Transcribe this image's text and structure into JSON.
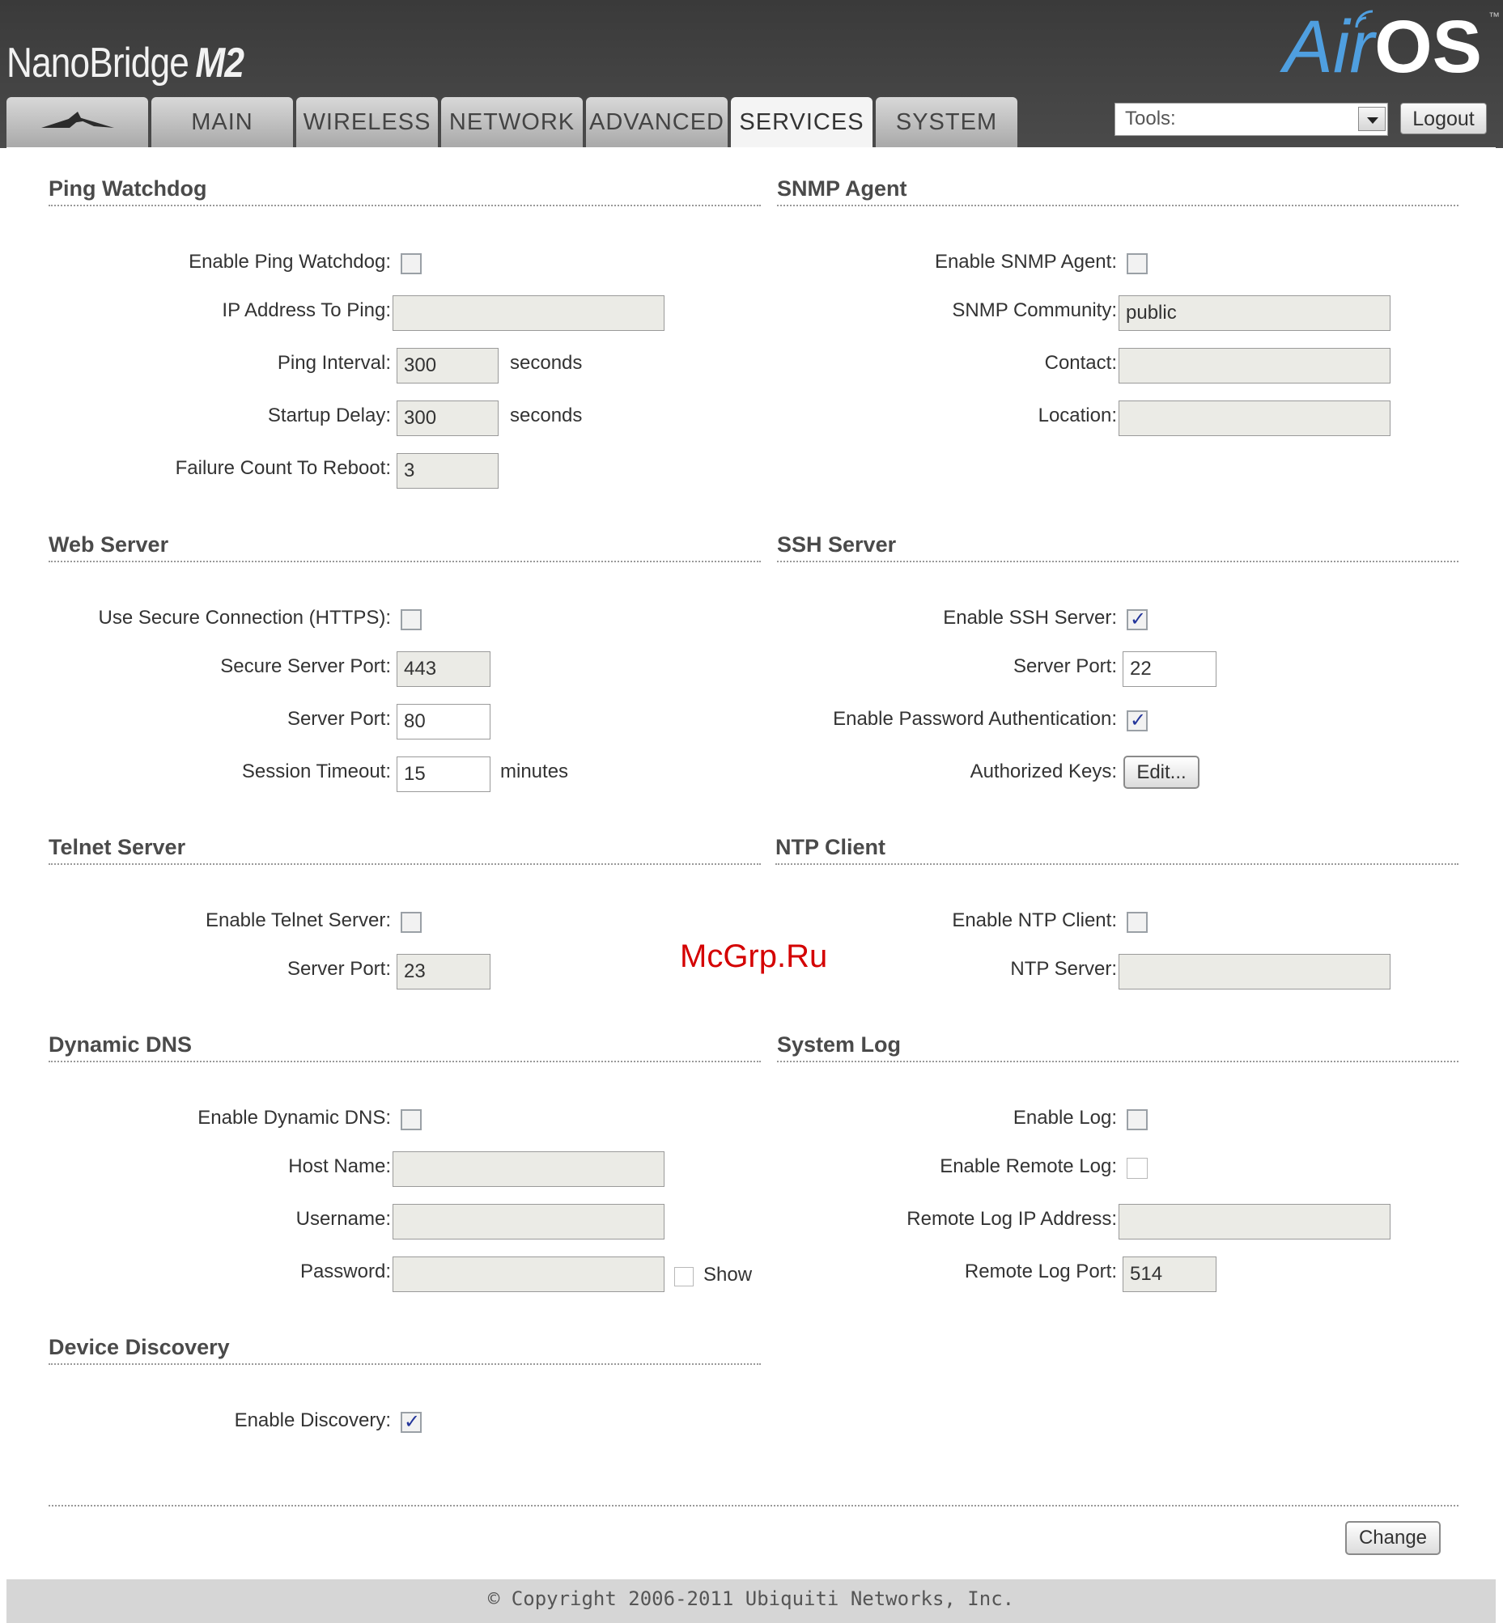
{
  "header": {
    "product_name": "NanoBridge",
    "product_model": "M2",
    "logo_air": "Air",
    "logo_os": "OS",
    "logo_tm": "™"
  },
  "tabs": [
    {
      "label": "",
      "icon": "ubiquiti-logo-icon"
    },
    {
      "label": "MAIN"
    },
    {
      "label": "WIRELESS"
    },
    {
      "label": "NETWORK"
    },
    {
      "label": "ADVANCED"
    },
    {
      "label": "SERVICES",
      "active": true
    },
    {
      "label": "SYSTEM"
    }
  ],
  "tools": {
    "label": "Tools:"
  },
  "logout_label": "Logout",
  "ping_watchdog": {
    "title": "Ping Watchdog",
    "enable_label": "Enable Ping Watchdog:",
    "ip_label": "IP Address To Ping:",
    "ip_value": "",
    "interval_label": "Ping Interval:",
    "interval_value": "300",
    "interval_unit": "seconds",
    "startup_label": "Startup Delay:",
    "startup_value": "300",
    "startup_unit": "seconds",
    "failure_label": "Failure Count To Reboot:",
    "failure_value": "3"
  },
  "snmp": {
    "title": "SNMP Agent",
    "enable_label": "Enable SNMP Agent:",
    "community_label": "SNMP Community:",
    "community_value": "public",
    "contact_label": "Contact:",
    "contact_value": "",
    "location_label": "Location:",
    "location_value": ""
  },
  "web_server": {
    "title": "Web Server",
    "https_label": "Use Secure Connection (HTTPS):",
    "secure_port_label": "Secure Server Port:",
    "secure_port_value": "443",
    "port_label": "Server Port:",
    "port_value": "80",
    "timeout_label": "Session Timeout:",
    "timeout_value": "15",
    "timeout_unit": "minutes"
  },
  "ssh_server": {
    "title": "SSH Server",
    "enable_label": "Enable SSH Server:",
    "port_label": "Server Port:",
    "port_value": "22",
    "pass_auth_label": "Enable Password Authentication:",
    "keys_label": "Authorized Keys:",
    "edit_label": "Edit..."
  },
  "watermark": "McGrp.Ru",
  "telnet": {
    "title": "Telnet Server",
    "enable_label": "Enable Telnet Server:",
    "port_label": "Server Port:",
    "port_value": "23"
  },
  "ntp": {
    "title": "NTP Client",
    "enable_label": "Enable NTP Client:",
    "server_label": "NTP Server:",
    "server_value": ""
  },
  "ddns": {
    "title": "Dynamic DNS",
    "enable_label": "Enable Dynamic DNS:",
    "host_label": "Host Name:",
    "host_value": "",
    "user_label": "Username:",
    "user_value": "",
    "pass_label": "Password:",
    "pass_value": "",
    "show_label": "Show"
  },
  "syslog": {
    "title": "System Log",
    "enable_label": "Enable Log:",
    "remote_label": "Enable Remote Log:",
    "ip_label": "Remote Log IP Address:",
    "ip_value": "",
    "port_label": "Remote Log Port:",
    "port_value": "514"
  },
  "discovery": {
    "title": "Device Discovery",
    "enable_label": "Enable Discovery:"
  },
  "change_label": "Change",
  "footer": {
    "copyright": "© Copyright 2006-2011 Ubiquiti Networks, Inc."
  }
}
